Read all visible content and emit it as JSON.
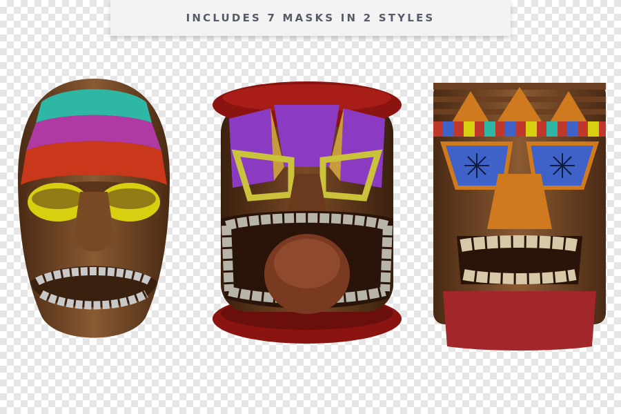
{
  "banner": {
    "text": "INCLUDES 7 MASKS IN 2 STYLES"
  },
  "masks": [
    {
      "name": "mask-bands-yellow-eyes",
      "colors": [
        "#2fb7a5",
        "#b03aa3",
        "#c9381a",
        "#d8cf10",
        "#7a4a25"
      ]
    },
    {
      "name": "mask-angry-purple",
      "colors": [
        "#8b1410",
        "#8a3bc2",
        "#c79a3d",
        "#b7b5a9",
        "#6b3a1e"
      ]
    },
    {
      "name": "mask-totem-blue-eyes",
      "colors": [
        "#d07a1f",
        "#3f62c9",
        "#c0382c",
        "#a2272a",
        "#7a4a25"
      ]
    }
  ]
}
